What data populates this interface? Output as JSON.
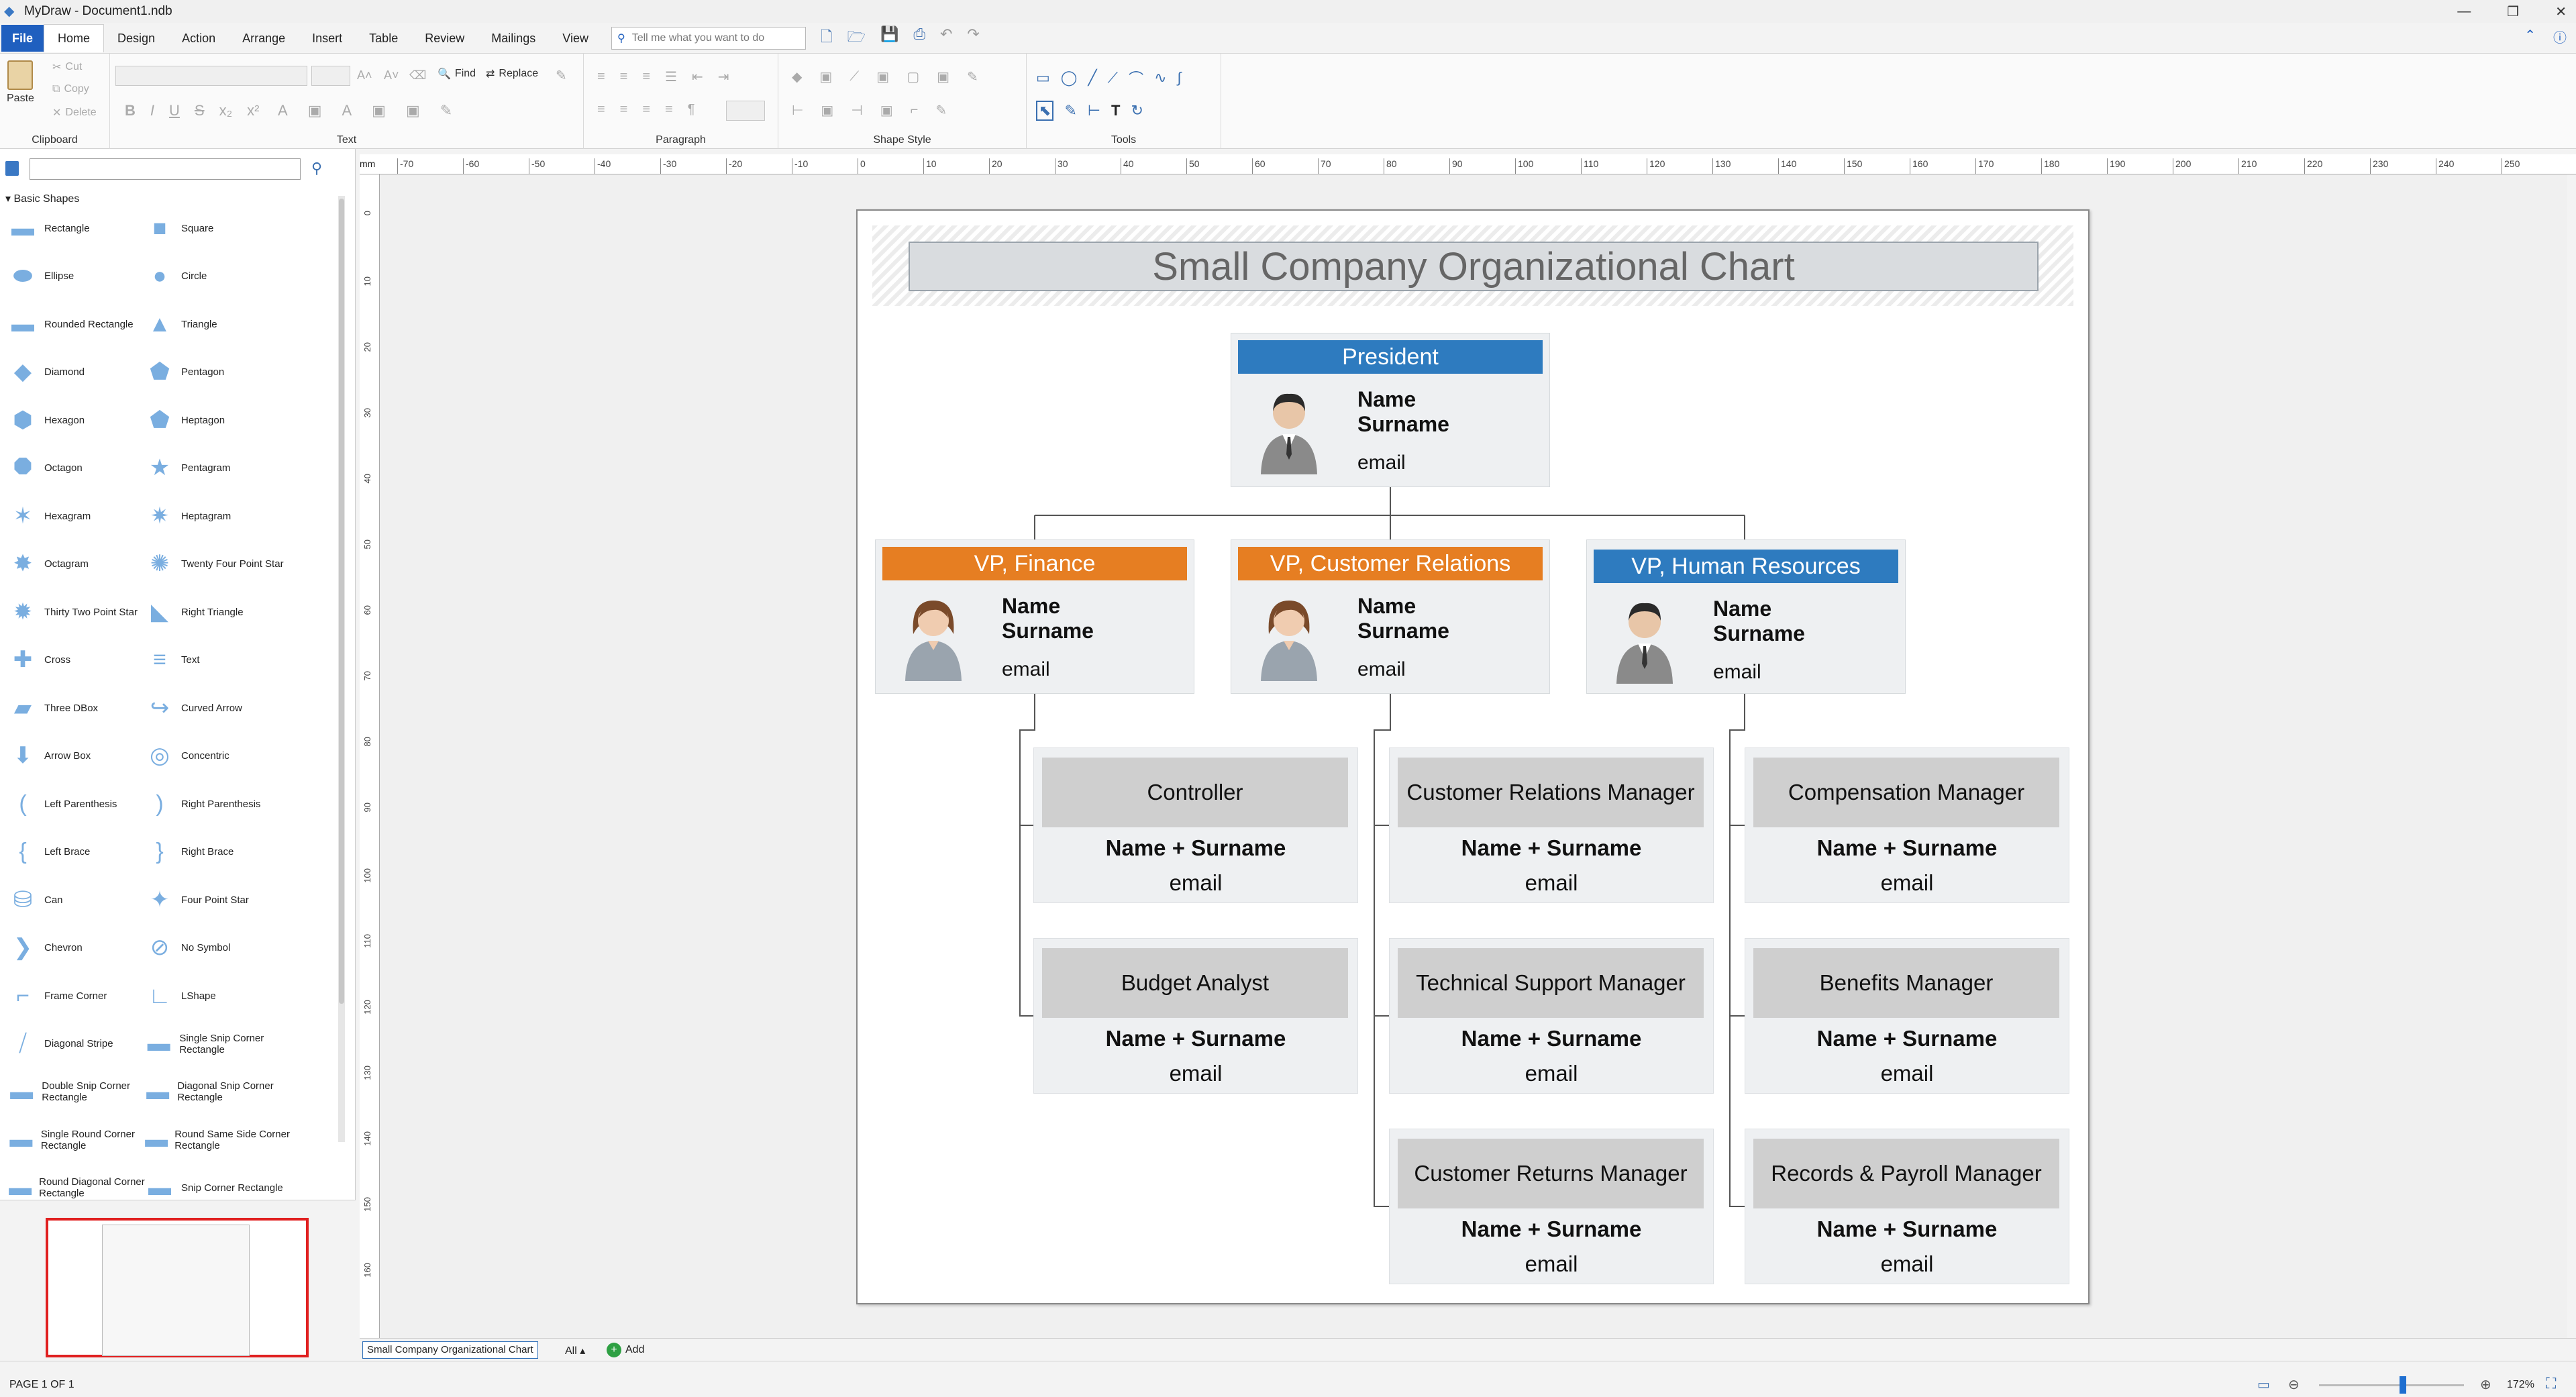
{
  "window": {
    "title": "MyDraw - Document1.ndb"
  },
  "ribbon_tabs": [
    "File",
    "Home",
    "Design",
    "Action",
    "Arrange",
    "Insert",
    "Table",
    "Review",
    "Mailings",
    "View"
  ],
  "tellme_placeholder": "Tell me what you want to do",
  "clipboard": {
    "paste": "Paste",
    "cut": "Cut",
    "copy": "Copy",
    "delete": "Delete",
    "label": "Clipboard"
  },
  "text_group": {
    "find": "Find",
    "replace": "Replace",
    "label": "Text"
  },
  "groups": {
    "paragraph": "Paragraph",
    "shape_style": "Shape Style",
    "tools": "Tools"
  },
  "sidebar": {
    "category": "Basic Shapes",
    "shapes": [
      "Rectangle",
      "Square",
      "Ellipse",
      "Circle",
      "Rounded Rectangle",
      "Triangle",
      "Diamond",
      "Pentagon",
      "Hexagon",
      "Heptagon",
      "Octagon",
      "Pentagram",
      "Hexagram",
      "Heptagram",
      "Octagram",
      "Twenty Four Point Star",
      "Thirty Two Point Star",
      "Right Triangle",
      "Cross",
      "Text",
      "Three DBox",
      "Curved Arrow",
      "Arrow Box",
      "Concentric",
      "Left Parenthesis",
      "Right Parenthesis",
      "Left Brace",
      "Right Brace",
      "Can",
      "Four Point Star",
      "Chevron",
      "No Symbol",
      "Frame Corner",
      "LShape",
      "Diagonal Stripe",
      "Single Snip Corner Rectangle",
      "Double Snip Corner Rectangle",
      "Diagonal Snip Corner Rectangle",
      "Single Round Corner Rectangle",
      "Round Same Side Corner Rectangle",
      "Round Diagonal Corner Rectangle",
      "Snip Corner Rectangle"
    ]
  },
  "ruler": {
    "unit": "mm",
    "h_labels": [
      "-70",
      "-60",
      "-50",
      "-40",
      "-30",
      "-20",
      "-10",
      "0",
      "10",
      "20",
      "30",
      "40",
      "50",
      "60",
      "70",
      "80",
      "90",
      "100",
      "110",
      "120",
      "130",
      "140",
      "150",
      "160",
      "170",
      "180",
      "190",
      "200",
      "210",
      "220",
      "230",
      "240",
      "250"
    ],
    "v_labels": [
      "0",
      "10",
      "20",
      "30",
      "40",
      "50",
      "60",
      "70",
      "80",
      "90",
      "100",
      "110",
      "120",
      "130",
      "140",
      "150",
      "160"
    ]
  },
  "chart": {
    "title": "Small Company Organizational Chart",
    "president": {
      "role": "President",
      "name": "Name",
      "surname": "Surname",
      "email": "email",
      "color": "#2e7bbf"
    },
    "vps": [
      {
        "role": "VP, Finance",
        "name": "Name",
        "surname": "Surname",
        "email": "email",
        "color": "#e67e22"
      },
      {
        "role": "VP, Customer Relations",
        "name": "Name",
        "surname": "Surname",
        "email": "email",
        "color": "#e67e22"
      },
      {
        "role": "VP, Human Resources",
        "name": "Name",
        "surname": "Surname",
        "email": "email",
        "color": "#2e7bbf"
      }
    ],
    "managers": [
      {
        "role": "Controller",
        "name": "Name + Surname",
        "email": "email"
      },
      {
        "role": "Budget Analyst",
        "name": "Name + Surname",
        "email": "email"
      },
      {
        "role": "Customer Relations Manager",
        "name": "Name + Surname",
        "email": "email"
      },
      {
        "role": "Technical Support Manager",
        "name": "Name + Surname",
        "email": "email"
      },
      {
        "role": "Customer Returns Manager",
        "name": "Name + Surname",
        "email": "email"
      },
      {
        "role": "Compensation Manager",
        "name": "Name + Surname",
        "email": "email"
      },
      {
        "role": "Benefits Manager",
        "name": "Name + Surname",
        "email": "email"
      },
      {
        "role": "Records & Payroll Manager",
        "name": "Name + Surname",
        "email": "email"
      }
    ]
  },
  "page_tabs": {
    "current": "Small Company Organizational Chart",
    "all": "All",
    "add": "Add"
  },
  "status": {
    "page": "PAGE 1 OF 1",
    "zoom": "172%"
  }
}
